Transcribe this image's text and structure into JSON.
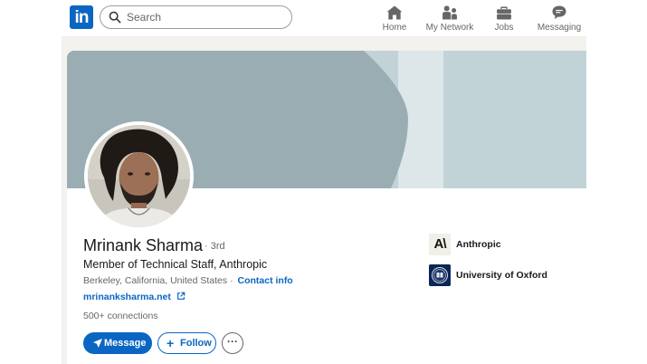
{
  "topnav": {
    "logo_text": "in",
    "search": {
      "placeholder": "Search"
    },
    "items": [
      {
        "label": "Home"
      },
      {
        "label": "My Network"
      },
      {
        "label": "Jobs"
      },
      {
        "label": "Messaging"
      }
    ]
  },
  "profile": {
    "name": "Mrinank Sharma",
    "degree": "· 3rd",
    "headline": "Member of Technical Staff, Anthropic",
    "location": "Berkeley, California, United States",
    "contact_prefix": "·",
    "contact_info": "Contact info",
    "website": "mrinanksharma.net",
    "connections": "500+ connections",
    "actions": {
      "message": "Message",
      "follow": "Follow",
      "more": "···"
    },
    "organizations": [
      {
        "name": "Anthropic",
        "logo_text": "A\\"
      },
      {
        "name": "University of Oxford"
      }
    ]
  },
  "colors": {
    "brand": "#0a66c2",
    "banner_light": "#c2d3d8",
    "banner_dark": "#9aadb2",
    "page_bg": "#f4f2ee"
  }
}
